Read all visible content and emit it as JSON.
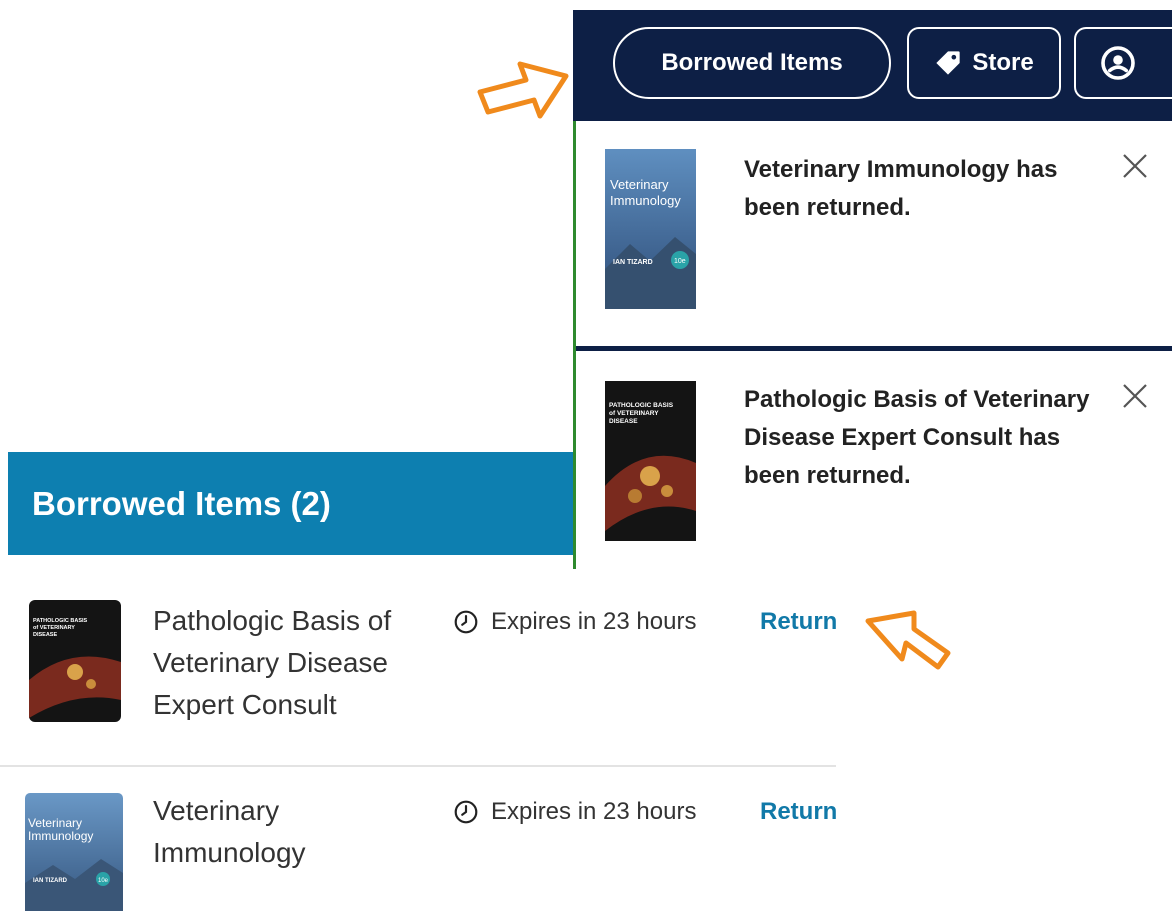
{
  "nav": {
    "borrowed_label": "Borrowed Items",
    "store_label": "Store",
    "store_icon": "tag-icon",
    "account_icon": "user-circle-icon"
  },
  "notifications": [
    {
      "text": "Veterinary Immunology has been returned.",
      "cover_title": "Veterinary Immunology",
      "cover_author": "IAN TIZARD",
      "cover_edition": "10e"
    },
    {
      "text": "Pathologic Basis of Veterinary Disease Expert Consult has been returned.",
      "cover_title": "PATHOLOGIC BASIS of VETERINARY DISEASE"
    }
  ],
  "borrowed": {
    "header": "Borrowed Items (2)",
    "items": [
      {
        "title": "Pathologic Basis of Veterinary Disease Expert Consult",
        "expiry": "Expires in 23 hours",
        "action": "Return"
      },
      {
        "title": "Veterinary Immunology",
        "expiry": "Expires in 23 hours",
        "action": "Return"
      }
    ]
  },
  "colors": {
    "navy": "#0d1f45",
    "header_blue": "#0d7fb0",
    "link_blue": "#1179a8",
    "accent_green": "#2e8a2e",
    "arrow_orange": "#f08a1c"
  }
}
